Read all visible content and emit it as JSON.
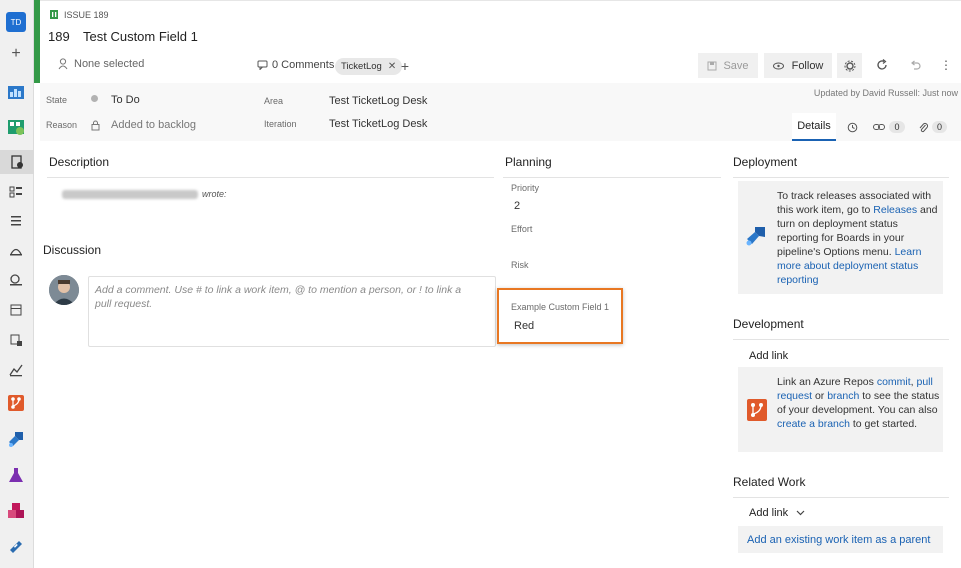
{
  "rail": {
    "avatar_initials": "TD",
    "plus": "+",
    "icons": [
      "overview-icon",
      "boards-icon",
      "work-items-icon",
      "backlogs-icon",
      "sprints-icon",
      "queries-icon",
      "delivery-plans-icon",
      "analytics-icon",
      "timeline-icon",
      "dashboards-icon",
      "repos-icon",
      "pipelines-icon",
      "test-plans-icon",
      "artifacts-icon",
      "ticketlog-icon"
    ]
  },
  "header": {
    "issue_label": "ISSUE 189",
    "id": "189",
    "title": "Test Custom Field 1",
    "assignee": "None selected",
    "comments": "0 Comments",
    "tag": "TicketLog",
    "save": "Save",
    "follow": "Follow"
  },
  "fields": {
    "state_label": "State",
    "state_value": "To Do",
    "reason_label": "Reason",
    "reason_value": "Added to backlog",
    "area_label": "Area",
    "area_value": "Test TicketLog Desk",
    "iteration_label": "Iteration",
    "iteration_value": "Test TicketLog Desk",
    "updated": "Updated by David Russell: Just now",
    "details_tab": "Details",
    "links_count": "0",
    "attachments_count": "0"
  },
  "description": {
    "title": "Description",
    "wrote": "wrote:"
  },
  "discussion": {
    "title": "Discussion",
    "placeholder": "Add a comment. Use # to link a work item, @ to mention a person, or ! to link a pull request."
  },
  "planning": {
    "title": "Planning",
    "priority_label": "Priority",
    "priority_value": "2",
    "effort_label": "Effort",
    "risk_label": "Risk",
    "custom_label": "Example Custom Field 1",
    "custom_value": "Red",
    "highlight_color": "#e87722"
  },
  "deployment": {
    "title": "Deployment",
    "text1": "To track releases associated with this work item, go to ",
    "link1": "Releases",
    "text2": " and turn on deployment status reporting for Boards in your pipeline's Options menu. ",
    "link2": "Learn more about deployment status reporting"
  },
  "development": {
    "title": "Development",
    "add_link": "Add link",
    "t1": "Link an Azure Repos ",
    "l1": "commit",
    "t2": ", ",
    "l2": "pull request",
    "t3": " or ",
    "l3": "branch",
    "t4": " to see the status of your development. You can also ",
    "l4": "create a branch",
    "t5": " to get started."
  },
  "related": {
    "title": "Related Work",
    "add_link": "Add link",
    "existing": "Add an existing work item as a parent"
  }
}
